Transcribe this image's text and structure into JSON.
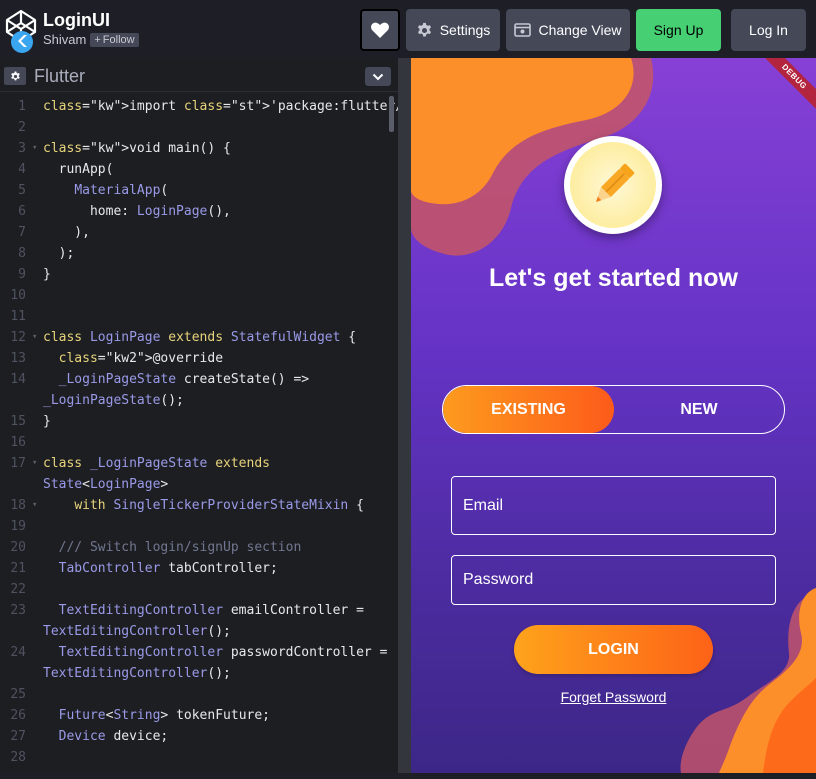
{
  "header": {
    "title": "LoginUI",
    "author": "Shivam",
    "follow_label": "Follow",
    "settings_label": "Settings",
    "change_view_label": "Change View",
    "signup_label": "Sign Up",
    "login_label": "Log In"
  },
  "editor": {
    "language": "Flutter",
    "lines": [
      {
        "n": "1",
        "text": "import 'package:flutter/material.dart';"
      },
      {
        "n": "2",
        "text": ""
      },
      {
        "n": "3",
        "text": "void main() {"
      },
      {
        "n": "4",
        "text": "  runApp("
      },
      {
        "n": "5",
        "text": "    MaterialApp("
      },
      {
        "n": "6",
        "text": "      home: LoginPage(),"
      },
      {
        "n": "7",
        "text": "    ),"
      },
      {
        "n": "8",
        "text": "  );"
      },
      {
        "n": "9",
        "text": "}"
      },
      {
        "n": "10",
        "text": ""
      },
      {
        "n": "11",
        "text": ""
      },
      {
        "n": "12",
        "text": "class LoginPage extends StatefulWidget {"
      },
      {
        "n": "13",
        "text": "  @override"
      },
      {
        "n": "14",
        "text": "  _LoginPageState createState() =>"
      },
      {
        "n": "",
        "text": "_LoginPageState();"
      },
      {
        "n": "15",
        "text": "}"
      },
      {
        "n": "16",
        "text": ""
      },
      {
        "n": "17",
        "text": "class _LoginPageState extends"
      },
      {
        "n": "",
        "text": "State<LoginPage>"
      },
      {
        "n": "18",
        "text": "    with SingleTickerProviderStateMixin {"
      },
      {
        "n": "19",
        "text": ""
      },
      {
        "n": "20",
        "text": "  /// Switch login/signUp section"
      },
      {
        "n": "21",
        "text": "  TabController tabController;"
      },
      {
        "n": "22",
        "text": ""
      },
      {
        "n": "23",
        "text": "  TextEditingController emailController ="
      },
      {
        "n": "",
        "text": "TextEditingController();"
      },
      {
        "n": "24",
        "text": "  TextEditingController passwordController ="
      },
      {
        "n": "",
        "text": "TextEditingController();"
      },
      {
        "n": "25",
        "text": ""
      },
      {
        "n": "26",
        "text": "  Future<String> tokenFuture;"
      },
      {
        "n": "27",
        "text": "  Device device;"
      },
      {
        "n": "28",
        "text": ""
      }
    ]
  },
  "preview": {
    "debug_label": "DEBUG",
    "headline": "Let's get started now",
    "tab_existing": "EXISTING",
    "tab_new": "NEW",
    "email_label": "Email",
    "password_label": "Password",
    "login_button": "LOGIN",
    "forget_password": "Forget Password"
  },
  "colors": {
    "accent_orange": "#fd7a1c",
    "signup_green": "#47cf73",
    "preview_purple": "#6533c6"
  }
}
